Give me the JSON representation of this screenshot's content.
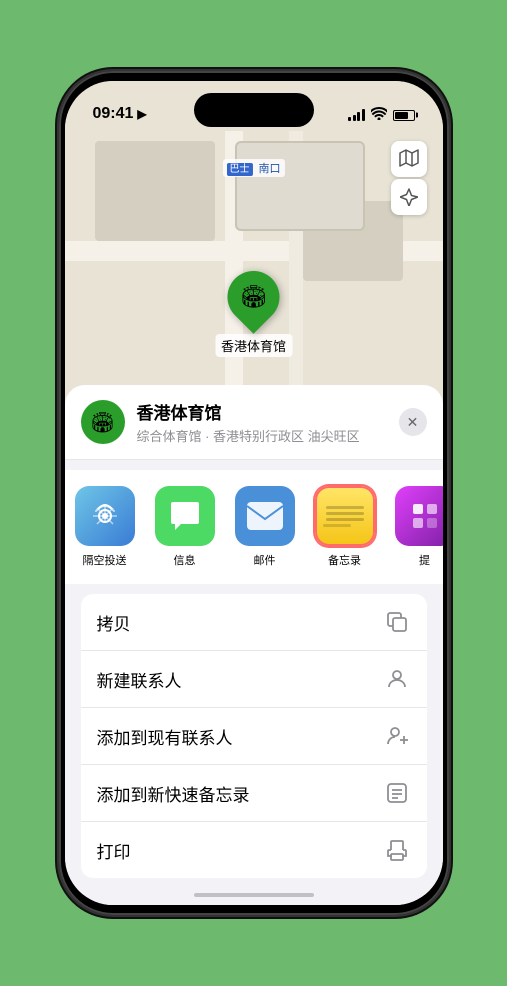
{
  "status_bar": {
    "time": "09:41",
    "location_icon": "▶"
  },
  "map": {
    "label": "南口",
    "label_prefix": "巴士"
  },
  "marker": {
    "label": "香港体育馆",
    "icon": "🏟"
  },
  "map_controls": {
    "map_btn": "🗺",
    "location_btn": "⬆"
  },
  "location_card": {
    "name": "香港体育馆",
    "desc": "综合体育馆 · 香港特别行政区 油尖旺区",
    "icon": "🏟"
  },
  "share_items": [
    {
      "label": "隔空投送",
      "type": "airdrop"
    },
    {
      "label": "信息",
      "type": "messages"
    },
    {
      "label": "邮件",
      "type": "mail"
    },
    {
      "label": "备忘录",
      "type": "notes"
    },
    {
      "label": "提",
      "type": "more"
    }
  ],
  "actions": [
    {
      "label": "拷贝",
      "icon": "copy"
    },
    {
      "label": "新建联系人",
      "icon": "person"
    },
    {
      "label": "添加到现有联系人",
      "icon": "person-add"
    },
    {
      "label": "添加到新快速备忘录",
      "icon": "note"
    },
    {
      "label": "打印",
      "icon": "print"
    }
  ]
}
